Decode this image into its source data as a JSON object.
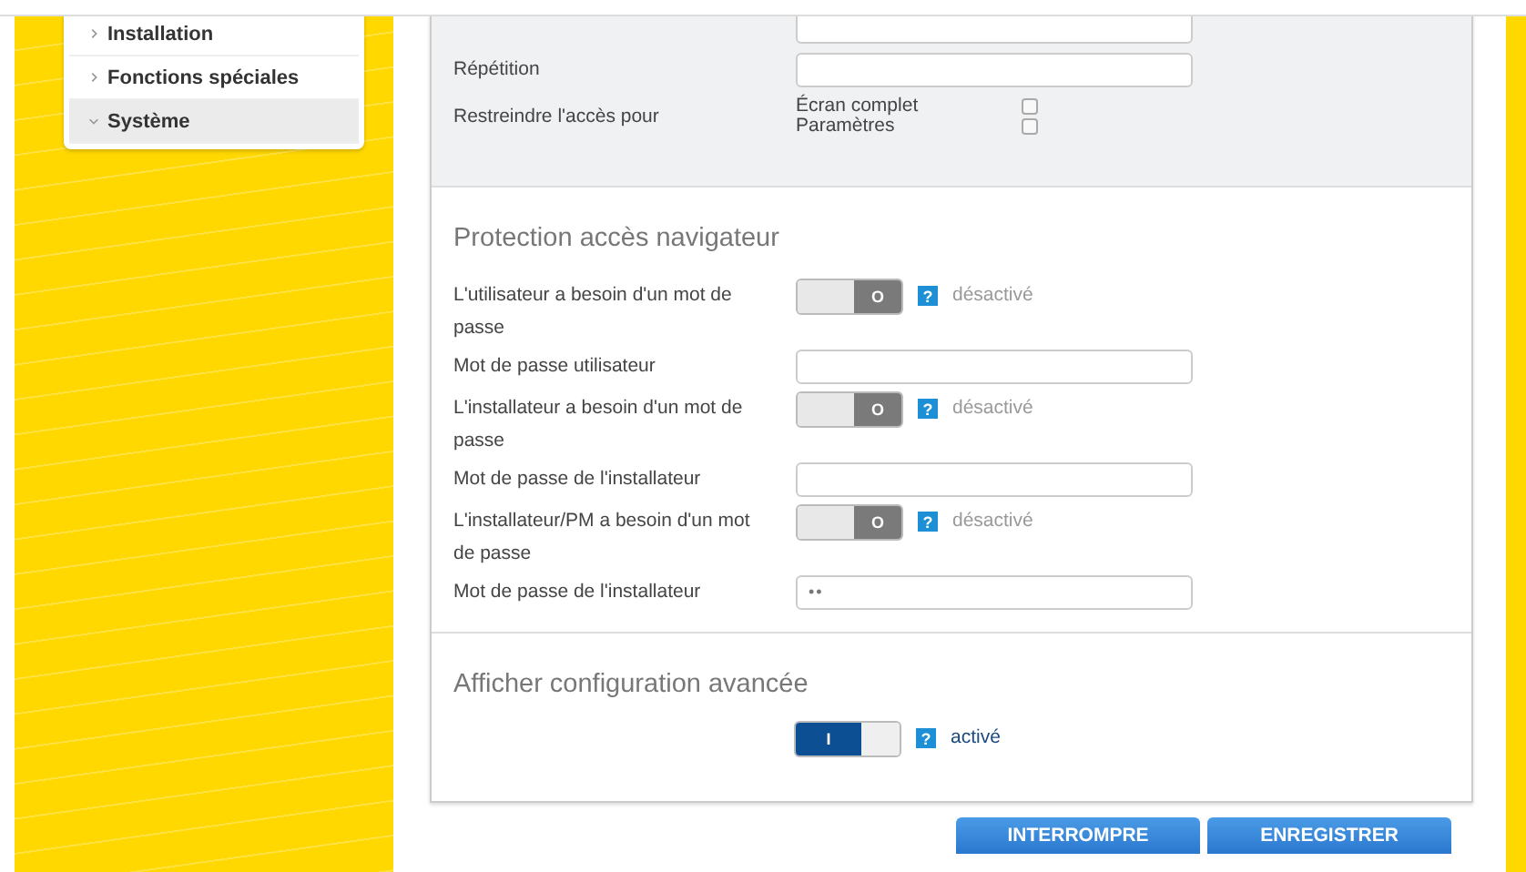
{
  "sidebar": {
    "items": [
      {
        "label": "Installation",
        "selected": false,
        "expanded": false
      },
      {
        "label": "Fonctions spéciales",
        "selected": false,
        "expanded": false
      },
      {
        "label": "Système",
        "selected": true,
        "expanded": true
      }
    ]
  },
  "access_section": {
    "rows": [
      {
        "kind": "field",
        "label": "",
        "value": ""
      },
      {
        "kind": "field",
        "label": "Répétition",
        "value": ""
      },
      {
        "kind": "checks",
        "label": "Restreindre l'accès pour",
        "options": [
          {
            "label": "Écran complet",
            "checked": false
          },
          {
            "label": "Paramètres",
            "checked": false
          }
        ]
      }
    ]
  },
  "browser_protection": {
    "title": "Protection accès navigateur",
    "rows": [
      {
        "kind": "toggle",
        "label": "L'utilisateur a besoin d'un mot de passe",
        "on": false,
        "glyph": "O",
        "help": "?",
        "status": "désactivé"
      },
      {
        "kind": "field",
        "label": "Mot de passe utilisateur",
        "value": ""
      },
      {
        "kind": "toggle",
        "label": "L'installateur a besoin d'un mot de passe",
        "on": false,
        "glyph": "O",
        "help": "?",
        "status": "désactivé"
      },
      {
        "kind": "field",
        "label": "Mot de passe de l'installateur",
        "value": ""
      },
      {
        "kind": "toggle",
        "label": "L'installateur/PM a besoin d'un mot de passe",
        "on": false,
        "glyph": "O",
        "help": "?",
        "status": "désactivé"
      },
      {
        "kind": "field",
        "label": "Mot de passe de l'installateur",
        "value": "••"
      }
    ]
  },
  "advanced": {
    "title": "Afficher configuration avancée",
    "toggle": {
      "on": true,
      "glyph": "I",
      "help": "?",
      "status": "activé"
    }
  },
  "buttons": [
    "INTERROMPRE",
    "ENREGISTRER"
  ]
}
